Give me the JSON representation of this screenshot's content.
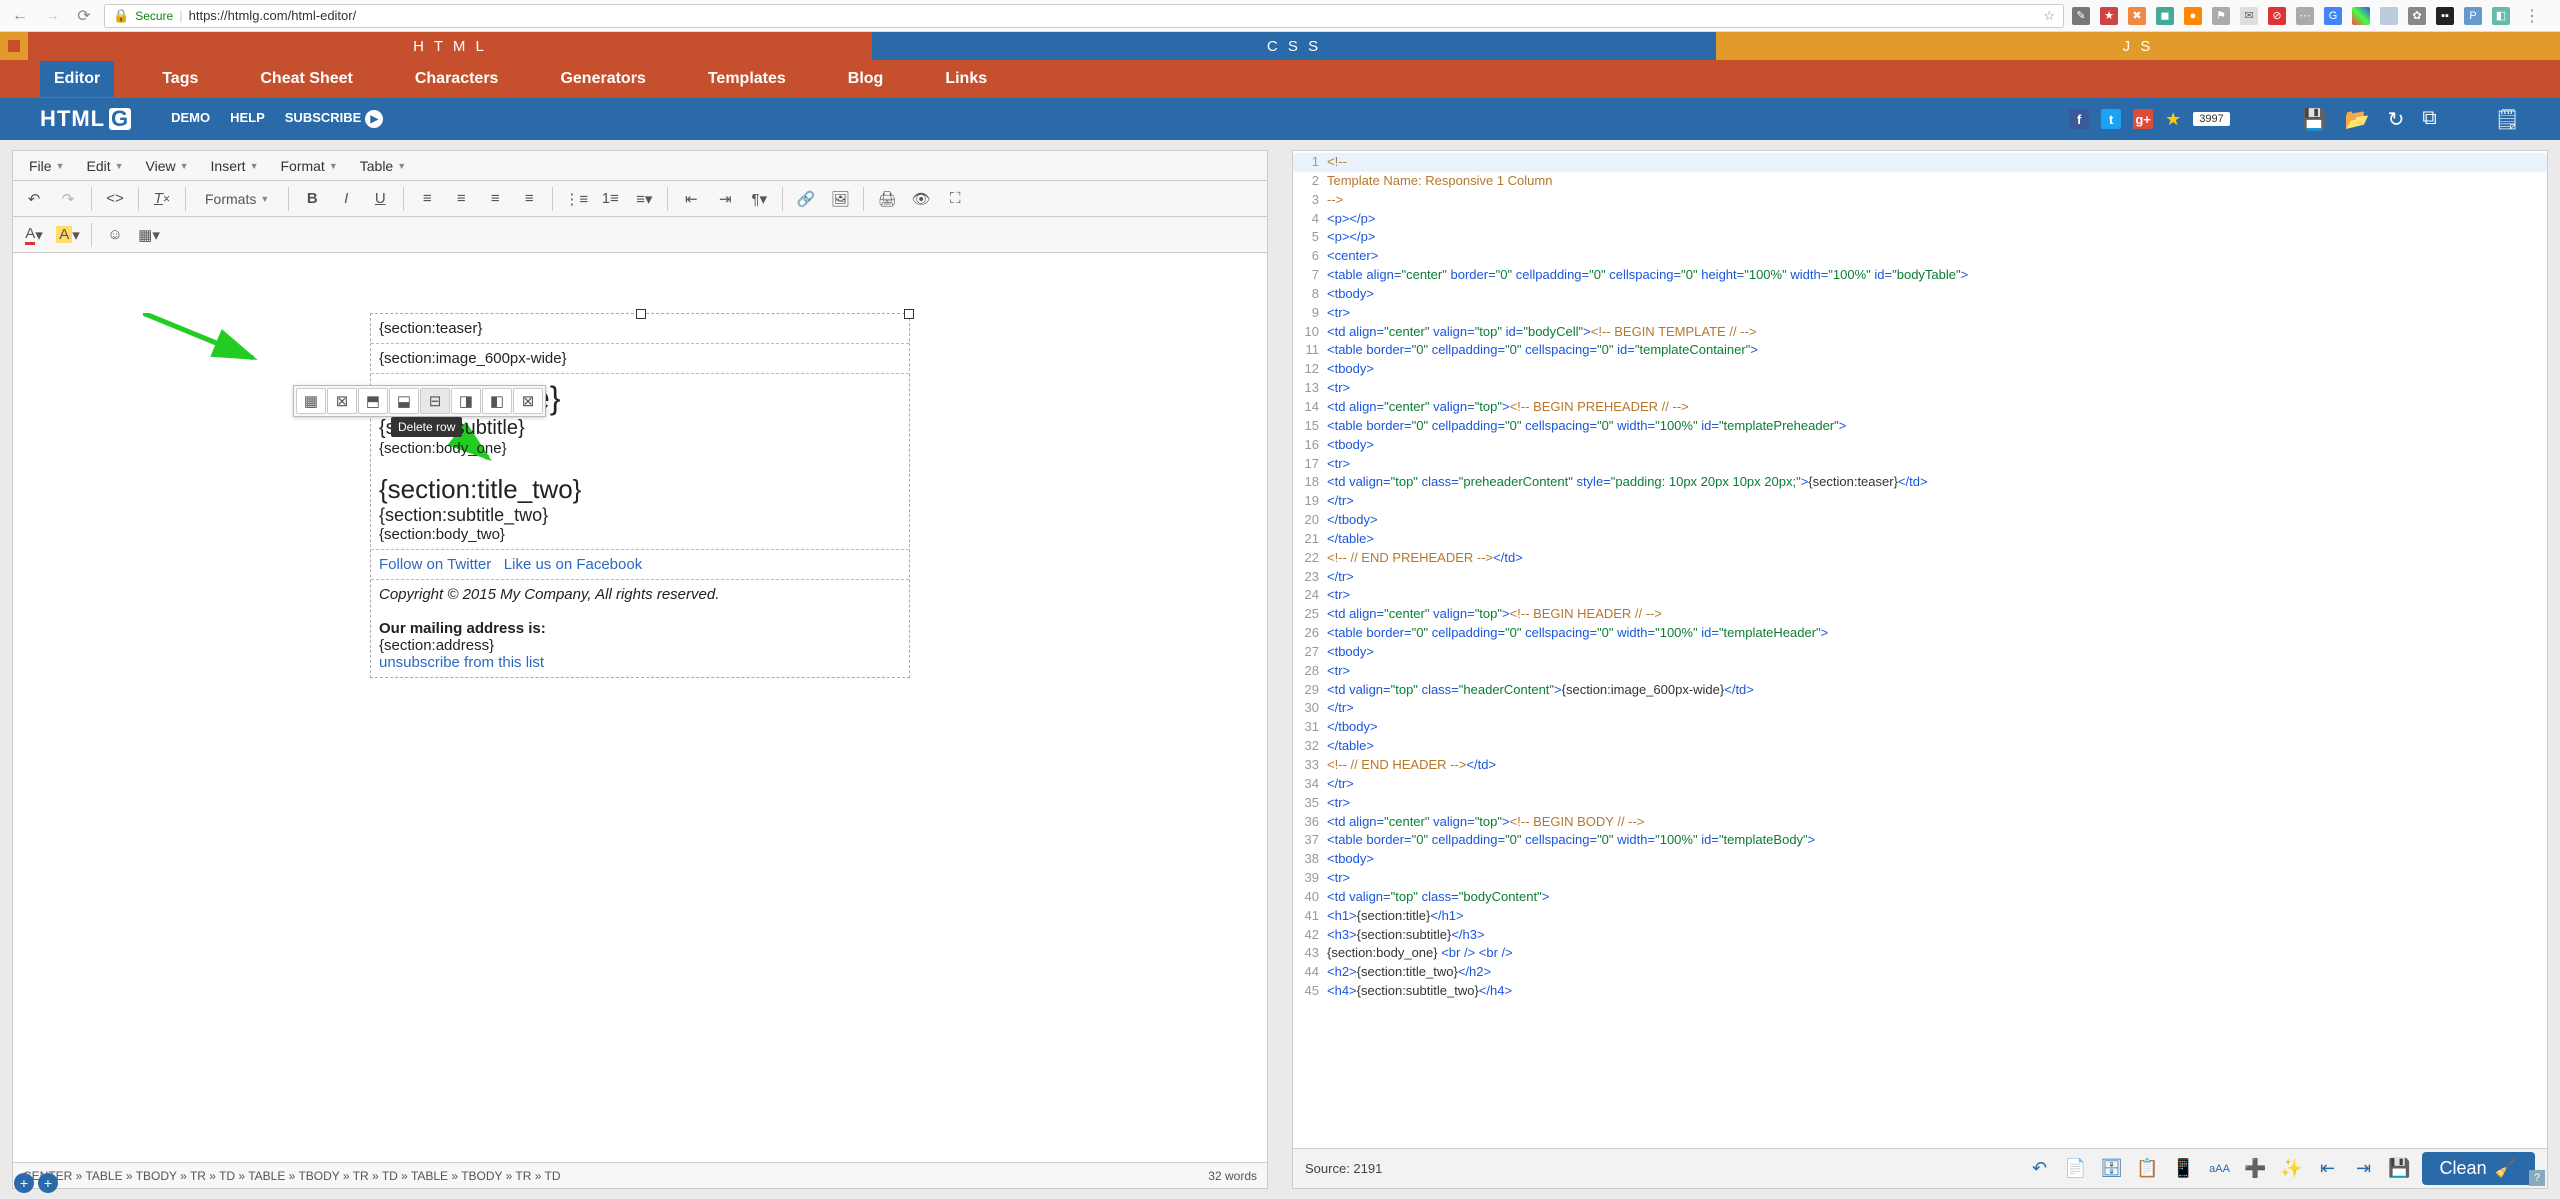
{
  "browser": {
    "secure_label": "Secure",
    "url": "https://htmlg.com/html-editor/"
  },
  "lang_tabs": {
    "html": "H T M L",
    "css": "C S S",
    "js": "J S"
  },
  "main_nav": [
    "Editor",
    "Tags",
    "Cheat Sheet",
    "Characters",
    "Generators",
    "Templates",
    "Blog",
    "Links"
  ],
  "brand": "HTML",
  "blue_links": {
    "demo": "DEMO",
    "help": "HELP",
    "subscribe": "SUBSCRIBE"
  },
  "social_counter": "3997",
  "menus": [
    "File",
    "Edit",
    "View",
    "Insert",
    "Format",
    "Table"
  ],
  "formats_label": "Formats",
  "tooltip": "Delete row",
  "template": {
    "teaser": "{section:teaser}",
    "image_row": "{section:image_600px-wide}",
    "title": "{section:title}",
    "subtitle": "{section:subtitle}",
    "body_one": "{section:body_one}",
    "title_two": "{section:title_two}",
    "subtitle_two": "{section:subtitle_two}",
    "body_two": "{section:body_two}",
    "twitter": "Follow on Twitter",
    "facebook": "Like us on Facebook",
    "copyright": "Copyright © 2015 My Company, All rights reserved.",
    "mailing_label": "Our mailing address is:",
    "address": "{section:address}",
    "unsubscribe": "unsubscribe from this list"
  },
  "breadcrumbs": "CENTER » TABLE » TBODY » TR » TD » TABLE » TBODY » TR » TD » TABLE » TBODY » TR » TD",
  "word_count": "32 words",
  "source_label": "Source: 2191",
  "clean_label": "Clean",
  "code_lines": [
    {
      "n": 1,
      "html": "<span class='cmt'>&lt;!--</span>"
    },
    {
      "n": 2,
      "html": "<span class='cmt'>Template Name: Responsive 1 Column</span>"
    },
    {
      "n": 3,
      "html": "<span class='cmt'>--&gt;</span>"
    },
    {
      "n": 4,
      "html": "<span class='tag'>&lt;p&gt;&lt;/p&gt;</span>"
    },
    {
      "n": 5,
      "html": "<span class='tag'>&lt;p&gt;&lt;/p&gt;</span>"
    },
    {
      "n": 6,
      "html": "<span class='tag'>&lt;center&gt;</span>"
    },
    {
      "n": 7,
      "html": "<span class='tag'>&lt;table</span> <span class='attr'>align=</span><span class='str'>\"center\"</span> <span class='attr'>border=</span><span class='str'>\"0\"</span> <span class='attr'>cellpadding=</span><span class='str'>\"0\"</span> <span class='attr'>cellspacing=</span><span class='str'>\"0\"</span> <span class='attr'>height=</span><span class='str'>\"100%\"</span> <span class='attr'>width=</span><span class='str'>\"100%\"</span> <span class='attr'>id=</span><span class='str'>\"bodyTable\"</span><span class='tag'>&gt;</span>"
    },
    {
      "n": 8,
      "html": "<span class='tag'>&lt;tbody&gt;</span>"
    },
    {
      "n": 9,
      "html": "<span class='tag'>&lt;tr&gt;</span>"
    },
    {
      "n": 10,
      "html": "<span class='tag'>&lt;td</span> <span class='attr'>align=</span><span class='str'>\"center\"</span> <span class='attr'>valign=</span><span class='str'>\"top\"</span> <span class='attr'>id=</span><span class='str'>\"bodyCell\"</span><span class='tag'>&gt;</span><span class='cmt'>&lt;!-- BEGIN TEMPLATE // --&gt;</span>"
    },
    {
      "n": 11,
      "html": "<span class='tag'>&lt;table</span> <span class='attr'>border=</span><span class='str'>\"0\"</span> <span class='attr'>cellpadding=</span><span class='str'>\"0\"</span> <span class='attr'>cellspacing=</span><span class='str'>\"0\"</span> <span class='attr'>id=</span><span class='str'>\"templateContainer\"</span><span class='tag'>&gt;</span>"
    },
    {
      "n": 12,
      "html": "<span class='tag'>&lt;tbody&gt;</span>"
    },
    {
      "n": 13,
      "html": "<span class='tag'>&lt;tr&gt;</span>"
    },
    {
      "n": 14,
      "html": "<span class='tag'>&lt;td</span> <span class='attr'>align=</span><span class='str'>\"center\"</span> <span class='attr'>valign=</span><span class='str'>\"top\"</span><span class='tag'>&gt;</span><span class='cmt'>&lt;!-- BEGIN PREHEADER // --&gt;</span>"
    },
    {
      "n": 15,
      "html": "<span class='tag'>&lt;table</span> <span class='attr'>border=</span><span class='str'>\"0\"</span> <span class='attr'>cellpadding=</span><span class='str'>\"0\"</span> <span class='attr'>cellspacing=</span><span class='str'>\"0\"</span> <span class='attr'>width=</span><span class='str'>\"100%\"</span> <span class='attr'>id=</span><span class='str'>\"templatePreheader\"</span><span class='tag'>&gt;</span>"
    },
    {
      "n": 16,
      "html": "<span class='tag'>&lt;tbody&gt;</span>"
    },
    {
      "n": 17,
      "html": "<span class='tag'>&lt;tr&gt;</span>"
    },
    {
      "n": 18,
      "html": "<span class='tag'>&lt;td</span> <span class='attr'>valign=</span><span class='str'>\"top\"</span> <span class='attr'>class=</span><span class='str'>\"preheaderContent\"</span> <span class='attr'>style=</span><span class='str'>\"padding: 10px 20px 10px 20px;\"</span><span class='tag'>&gt;</span><span class='plain'>{section:teaser}</span><span class='tag'>&lt;/td&gt;</span>"
    },
    {
      "n": 19,
      "html": "<span class='tag'>&lt;/tr&gt;</span>"
    },
    {
      "n": 20,
      "html": "<span class='tag'>&lt;/tbody&gt;</span>"
    },
    {
      "n": 21,
      "html": "<span class='tag'>&lt;/table&gt;</span>"
    },
    {
      "n": 22,
      "html": "<span class='cmt'>&lt;!-- // END PREHEADER --&gt;</span><span class='tag'>&lt;/td&gt;</span>"
    },
    {
      "n": 23,
      "html": "<span class='tag'>&lt;/tr&gt;</span>"
    },
    {
      "n": 24,
      "html": "<span class='tag'>&lt;tr&gt;</span>"
    },
    {
      "n": 25,
      "html": "<span class='tag'>&lt;td</span> <span class='attr'>align=</span><span class='str'>\"center\"</span> <span class='attr'>valign=</span><span class='str'>\"top\"</span><span class='tag'>&gt;</span><span class='cmt'>&lt;!-- BEGIN HEADER // --&gt;</span>"
    },
    {
      "n": 26,
      "html": "<span class='tag'>&lt;table</span> <span class='attr'>border=</span><span class='str'>\"0\"</span> <span class='attr'>cellpadding=</span><span class='str'>\"0\"</span> <span class='attr'>cellspacing=</span><span class='str'>\"0\"</span> <span class='attr'>width=</span><span class='str'>\"100%\"</span> <span class='attr'>id=</span><span class='str'>\"templateHeader\"</span><span class='tag'>&gt;</span>"
    },
    {
      "n": 27,
      "html": "<span class='tag'>&lt;tbody&gt;</span>"
    },
    {
      "n": 28,
      "html": "<span class='tag'>&lt;tr&gt;</span>"
    },
    {
      "n": 29,
      "html": "<span class='tag'>&lt;td</span> <span class='attr'>valign=</span><span class='str'>\"top\"</span> <span class='attr'>class=</span><span class='str'>\"headerContent\"</span><span class='tag'>&gt;</span><span class='plain'>{section:image_600px-wide}</span><span class='tag'>&lt;/td&gt;</span>"
    },
    {
      "n": 30,
      "html": "<span class='tag'>&lt;/tr&gt;</span>"
    },
    {
      "n": 31,
      "html": "<span class='tag'>&lt;/tbody&gt;</span>"
    },
    {
      "n": 32,
      "html": "<span class='tag'>&lt;/table&gt;</span>"
    },
    {
      "n": 33,
      "html": "<span class='cmt'>&lt;!-- // END HEADER --&gt;</span><span class='tag'>&lt;/td&gt;</span>"
    },
    {
      "n": 34,
      "html": "<span class='tag'>&lt;/tr&gt;</span>"
    },
    {
      "n": 35,
      "html": "<span class='tag'>&lt;tr&gt;</span>"
    },
    {
      "n": 36,
      "html": "<span class='tag'>&lt;td</span> <span class='attr'>align=</span><span class='str'>\"center\"</span> <span class='attr'>valign=</span><span class='str'>\"top\"</span><span class='tag'>&gt;</span><span class='cmt'>&lt;!-- BEGIN BODY // --&gt;</span>"
    },
    {
      "n": 37,
      "html": "<span class='tag'>&lt;table</span> <span class='attr'>border=</span><span class='str'>\"0\"</span> <span class='attr'>cellpadding=</span><span class='str'>\"0\"</span> <span class='attr'>cellspacing=</span><span class='str'>\"0\"</span> <span class='attr'>width=</span><span class='str'>\"100%\"</span> <span class='attr'>id=</span><span class='str'>\"templateBody\"</span><span class='tag'>&gt;</span>"
    },
    {
      "n": 38,
      "html": "<span class='tag'>&lt;tbody&gt;</span>"
    },
    {
      "n": 39,
      "html": "<span class='tag'>&lt;tr&gt;</span>"
    },
    {
      "n": 40,
      "html": "<span class='tag'>&lt;td</span> <span class='attr'>valign=</span><span class='str'>\"top\"</span> <span class='attr'>class=</span><span class='str'>\"bodyContent\"</span><span class='tag'>&gt;</span>"
    },
    {
      "n": 41,
      "html": "<span class='tag'>&lt;h1&gt;</span><span class='plain'>{section:title}</span><span class='tag'>&lt;/h1&gt;</span>"
    },
    {
      "n": 42,
      "html": "<span class='tag'>&lt;h3&gt;</span><span class='plain'>{section:subtitle}</span><span class='tag'>&lt;/h3&gt;</span>"
    },
    {
      "n": 43,
      "html": "<span class='plain'>{section:body_one} </span><span class='tag'>&lt;br /&gt; &lt;br /&gt;</span>"
    },
    {
      "n": 44,
      "html": "<span class='tag'>&lt;h2&gt;</span><span class='plain'>{section:title_two}</span><span class='tag'>&lt;/h2&gt;</span>"
    },
    {
      "n": 45,
      "html": "<span class='tag'>&lt;h4&gt;</span><span class='plain'>{section:subtitle_two}</span><span class='tag'>&lt;/h4&gt;</span>"
    }
  ]
}
